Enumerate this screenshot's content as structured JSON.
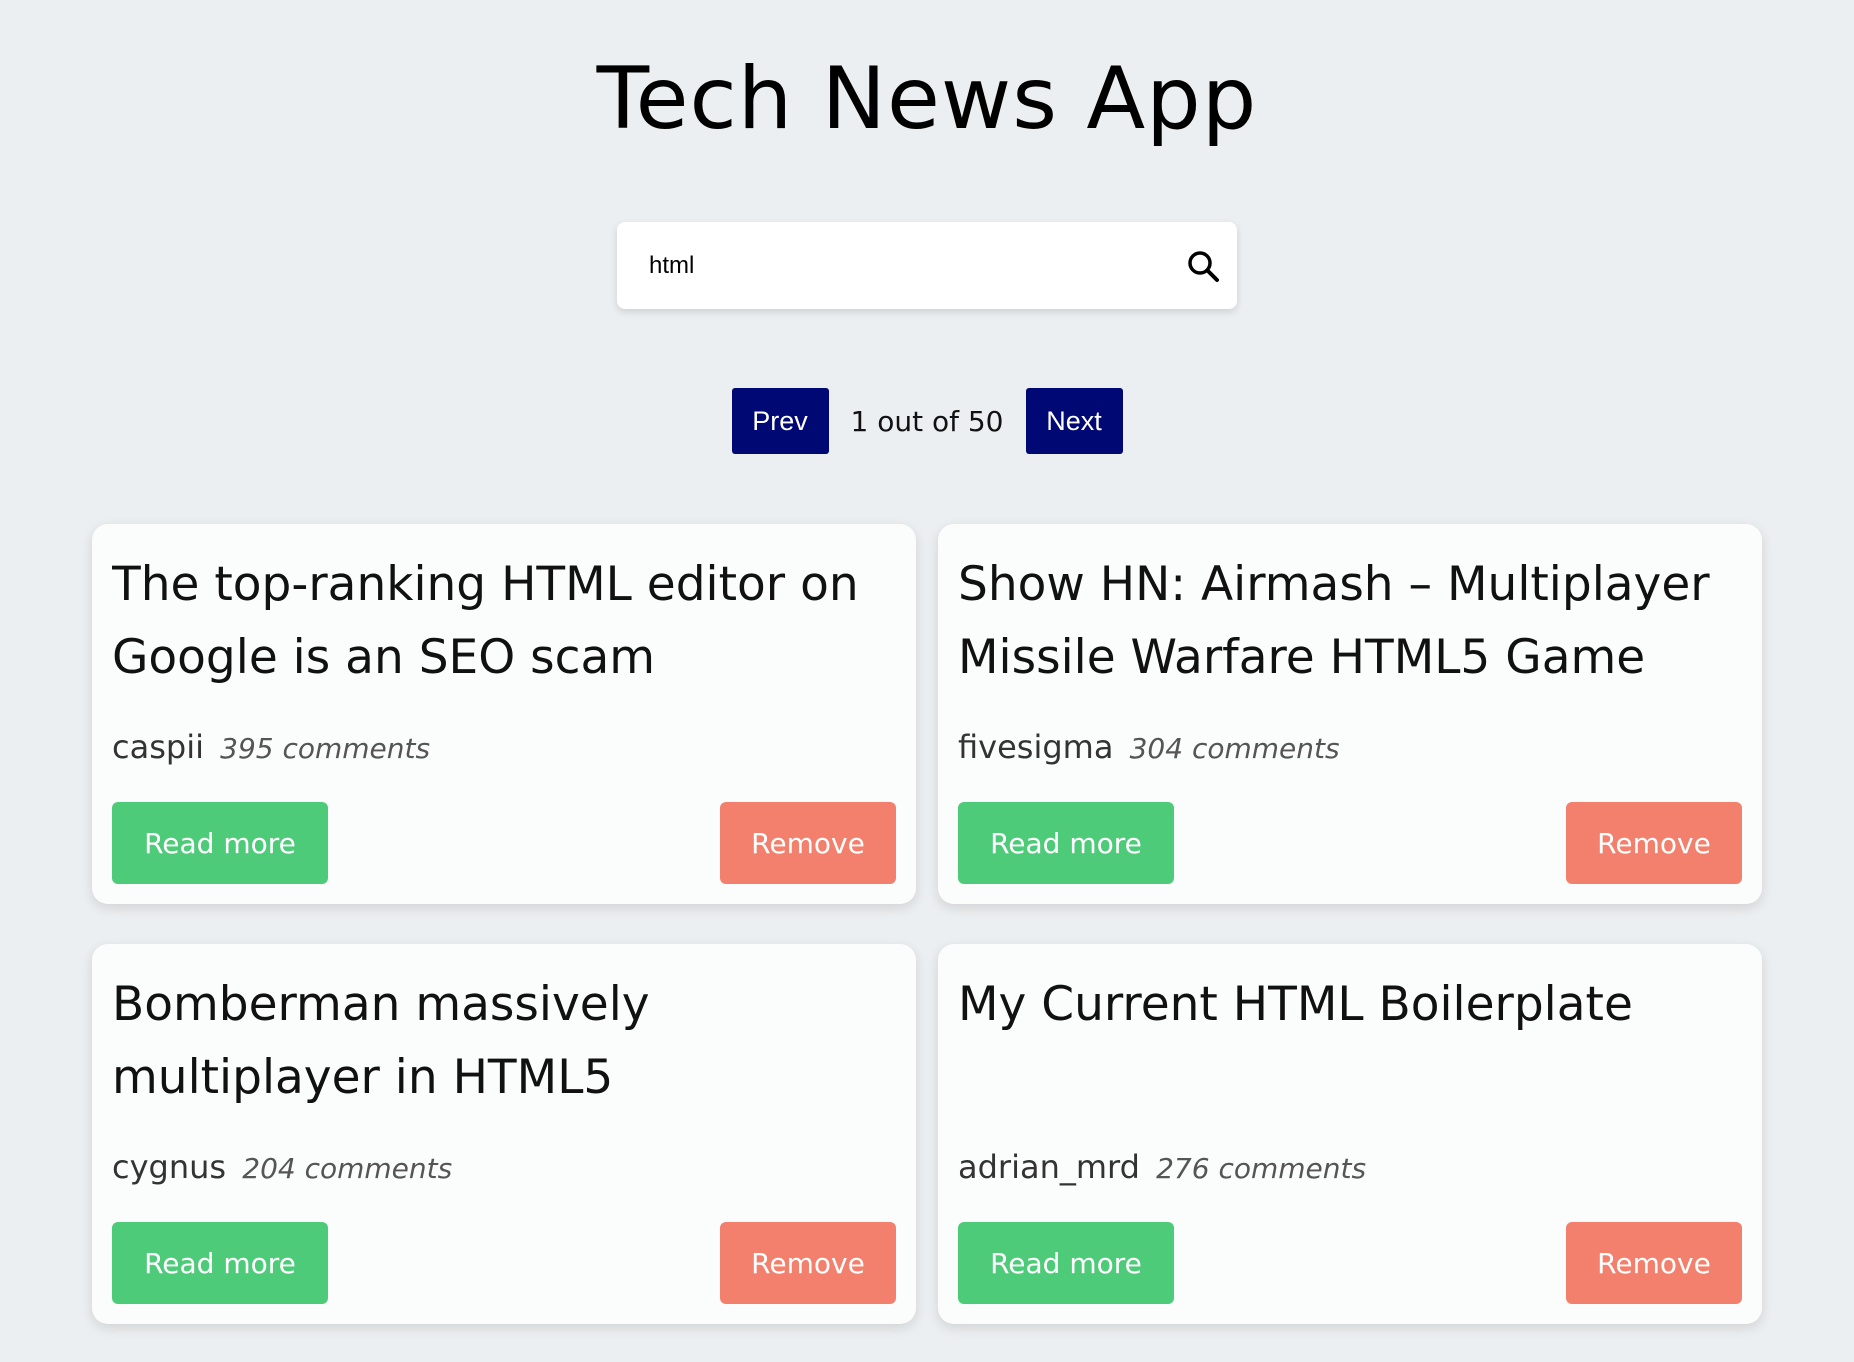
{
  "app": {
    "title": "Tech News App"
  },
  "search": {
    "value": "html",
    "icon": "search-icon"
  },
  "pagination": {
    "prev_label": "Prev",
    "info": "1 out of 50",
    "next_label": "Next",
    "button_color": "#000874"
  },
  "colors": {
    "background": "#eceff1",
    "read_more": "#4ecb79",
    "remove": "#f3806c"
  },
  "stories": [
    {
      "title": "The top-ranking HTML editor on Google is an SEO scam",
      "author": "caspii",
      "comments": "395 comments",
      "read_more_label": "Read more",
      "remove_label": "Remove"
    },
    {
      "title": "Show HN: Airmash – Multiplayer Missile Warfare HTML5 Game",
      "author": "fivesigma",
      "comments": "304 comments",
      "read_more_label": "Read more",
      "remove_label": "Remove"
    },
    {
      "title": "Bomberman massively multiplayer in HTML5",
      "author": "cygnus",
      "comments": "204 comments",
      "read_more_label": "Read more",
      "remove_label": "Remove"
    },
    {
      "title": "My Current HTML Boilerplate",
      "author": "adrian_mrd",
      "comments": "276 comments",
      "read_more_label": "Read more",
      "remove_label": "Remove"
    }
  ]
}
